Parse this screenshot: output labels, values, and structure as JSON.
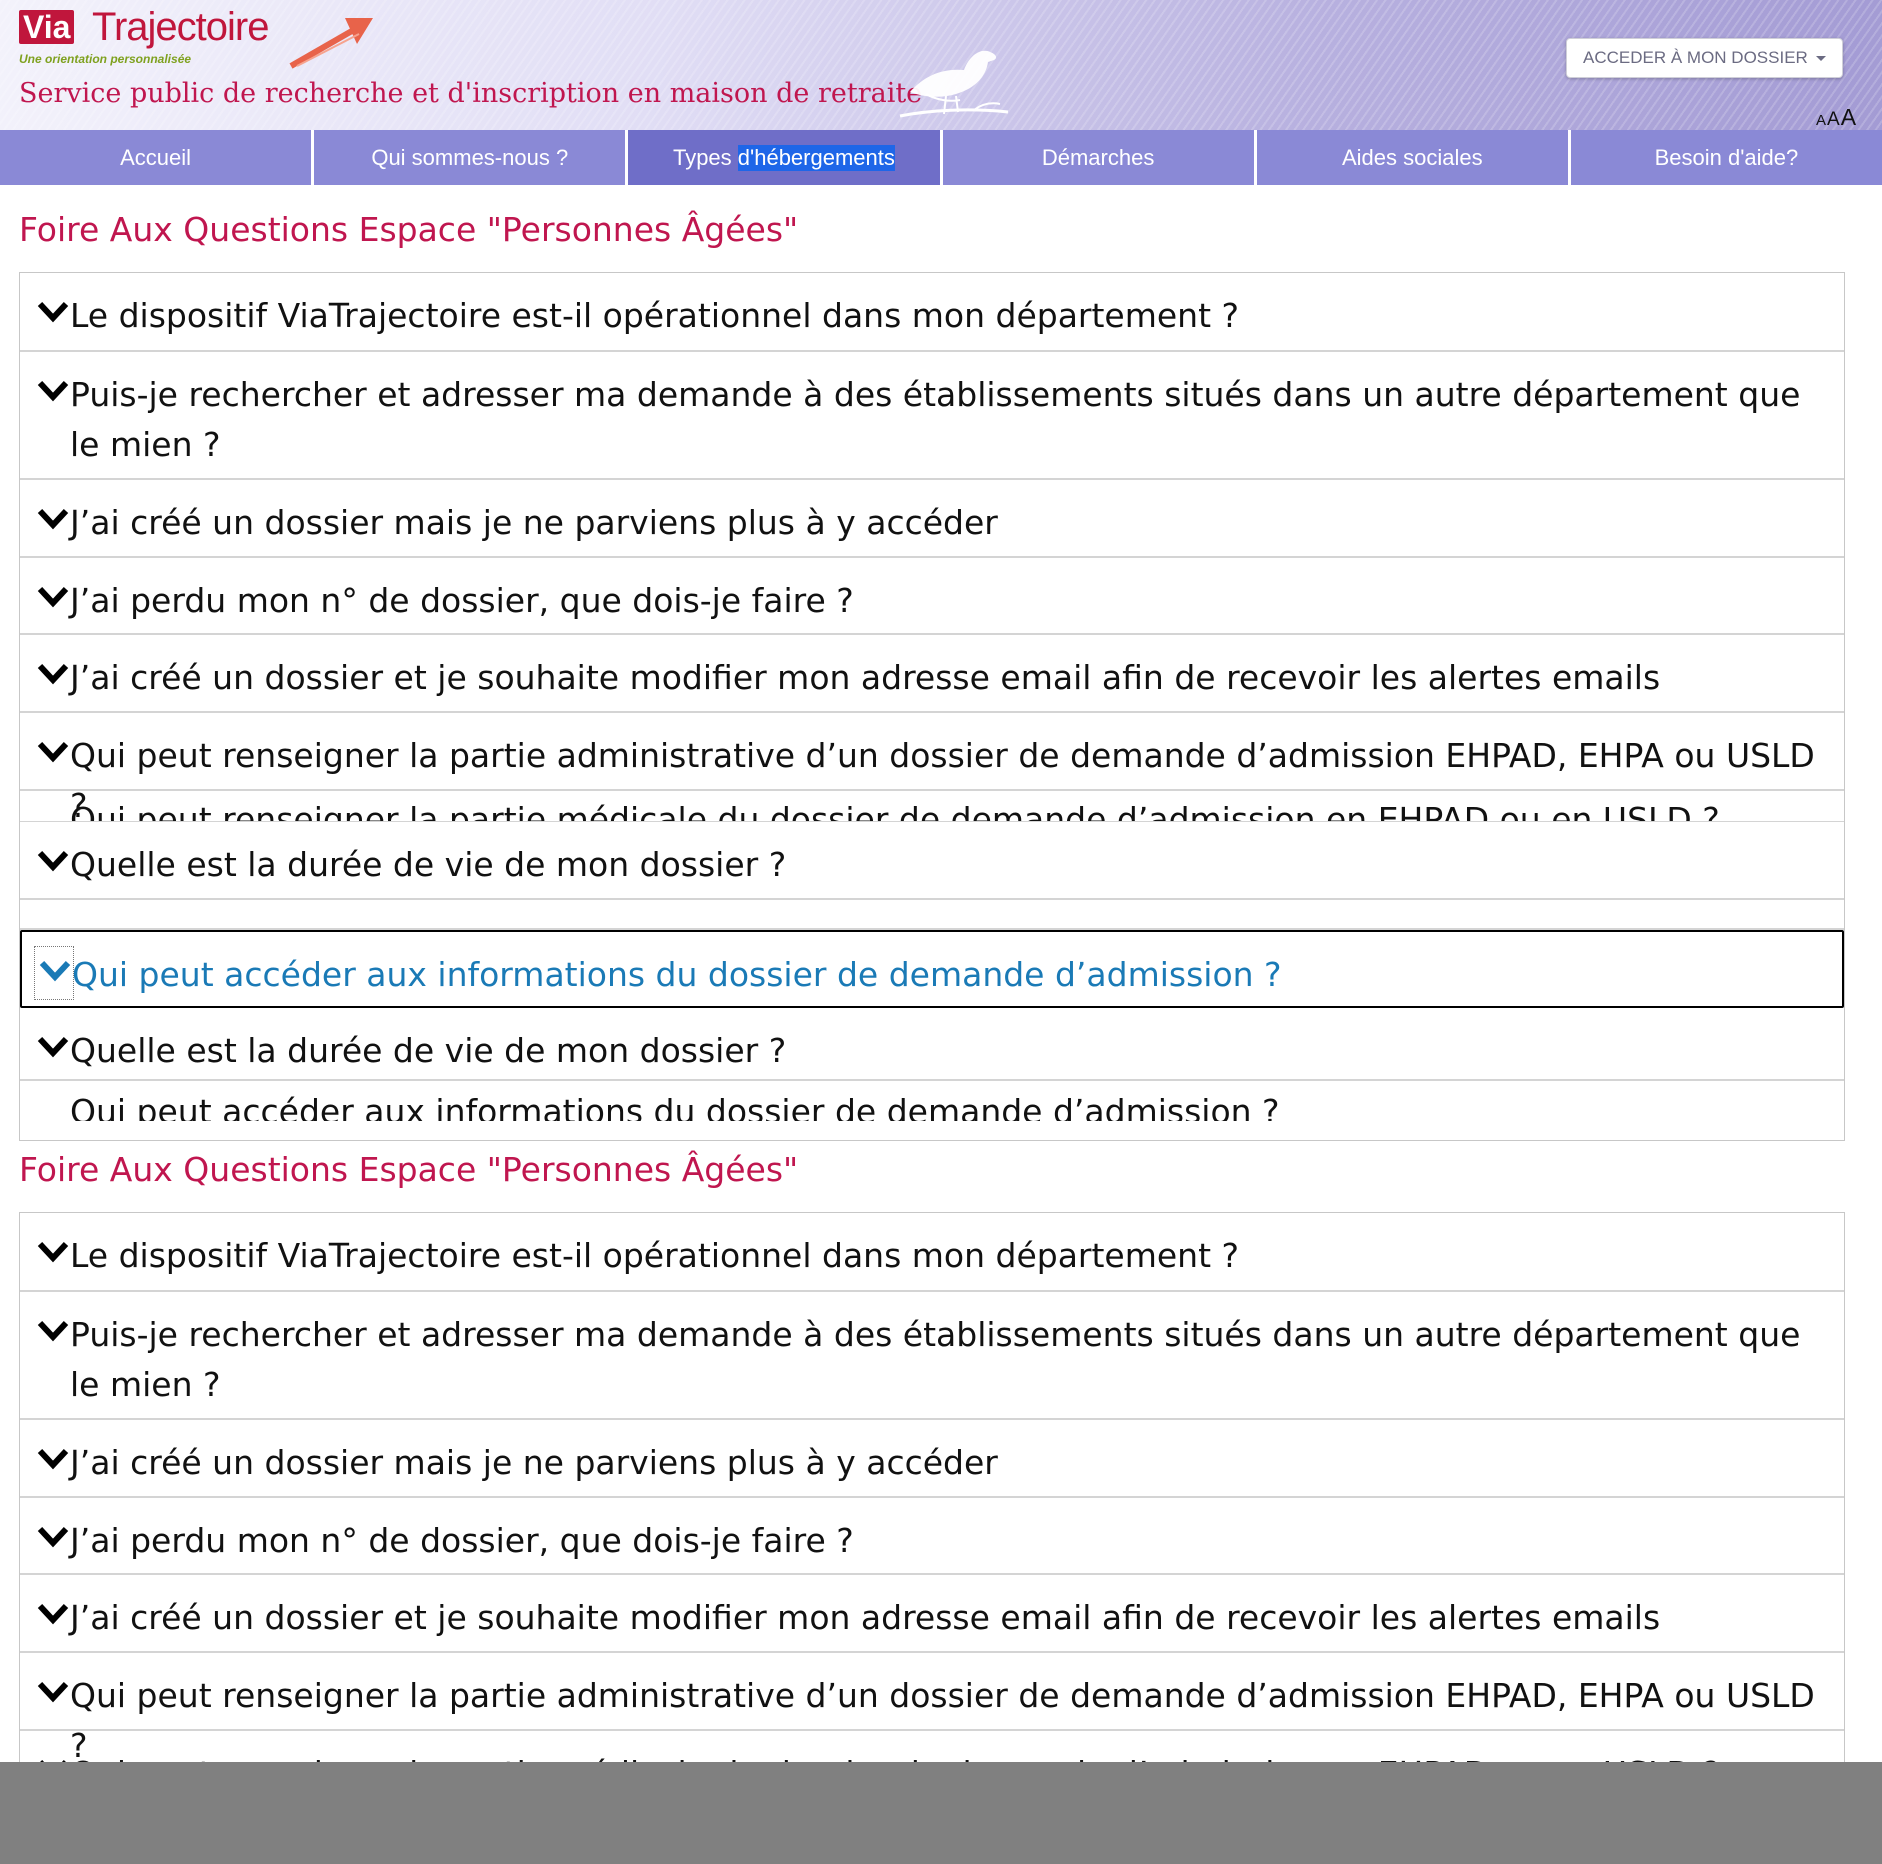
{
  "header": {
    "logo_via": "Via",
    "logo_trajectoire": "Trajectoire",
    "logo_tagline": "Une orientation personnalisée",
    "service_title": "Service public de recherche et d'inscription en maison de retraite",
    "access_button": "ACCEDER À MON DOSSIER",
    "font_small": "A",
    "font_medium": "A",
    "font_large": "A"
  },
  "nav": {
    "items": [
      {
        "label": "Accueil"
      },
      {
        "label": "Qui sommes-nous ?"
      },
      {
        "label_a": "Types ",
        "label_b": "d'hébergements"
      },
      {
        "label": "Démarches"
      },
      {
        "label": "Aides sociales"
      },
      {
        "label": "Besoin d'aide?"
      }
    ]
  },
  "faq": {
    "title": "Foire Aux Questions Espace \"Personnes Âgées\"",
    "questions": [
      "Le dispositif ViaTrajectoire est-il opérationnel dans mon département ?",
      "Puis-je rechercher et adresser ma demande à des établissements situés dans un autre département que le mien ?",
      "J’ai créé un dossier mais je ne parviens plus à y accéder",
      "J’ai perdu mon n° de dossier, que dois-je faire ?",
      "J’ai créé un dossier et je souhaite modifier mon adresse email afin de recevoir les alertes emails",
      "Qui peut renseigner la partie administrative d’un dossier de demande d’admission EHPAD, EHPA ou USLD ?",
      "Qui peut renseigner la partie médicale du dossier de demande d’admission en EHPAD ou en USLD ?",
      "Quelle est la durée de vie de mon dossier ?",
      "Qui peut accéder aux informations du dossier de demande d’admission ?"
    ]
  },
  "colors": {
    "brand": "#c0164f",
    "nav": "#8a89d6",
    "focus_text": "#1a7ab6"
  }
}
